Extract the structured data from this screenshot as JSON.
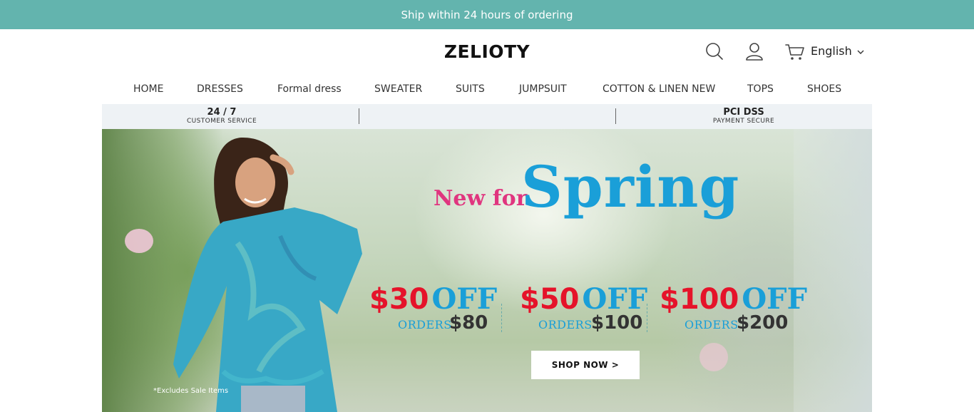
{
  "announcement": "Ship within 24 hours of ordering",
  "header": {
    "logo": "ZELIOTY",
    "language": "English",
    "icons": [
      "search-icon",
      "user-icon",
      "cart-icon",
      "chevron-down-icon"
    ]
  },
  "nav": {
    "items": [
      {
        "label": "HOME"
      },
      {
        "label": "DRESSES"
      },
      {
        "label": "Formal dress"
      },
      {
        "label": "SWEATER"
      },
      {
        "label": "SUITS"
      },
      {
        "label": "JUMPSUIT"
      },
      {
        "label": "COTTON & LINEN NEW"
      },
      {
        "label": "TOPS"
      },
      {
        "label": "SHOES"
      }
    ]
  },
  "trust_bar": {
    "left": {
      "big": "24 / 7",
      "small": "CUSTOMER SERVICE"
    },
    "right": {
      "big": "PCI DSS",
      "small": "PAYMENT SECURE"
    }
  },
  "hero": {
    "headline_small": "New for",
    "headline_big": "Spring",
    "deals": [
      {
        "amount": "$30",
        "off": "OFF",
        "orders": "ORDERS",
        "threshold": "$80"
      },
      {
        "amount": "$50",
        "off": "OFF",
        "orders": "ORDERS",
        "threshold": "$100"
      },
      {
        "amount": "$100",
        "off": "OFF",
        "orders": "ORDERS",
        "threshold": "$200"
      }
    ],
    "cta": "SHOP NOW >",
    "note": "*Excludes Sale Items"
  },
  "colors": {
    "announcement_bg": "#63b4ae",
    "accent_pink": "#e0357f",
    "accent_blue": "#1a9fd8",
    "accent_red": "#e5132a"
  }
}
